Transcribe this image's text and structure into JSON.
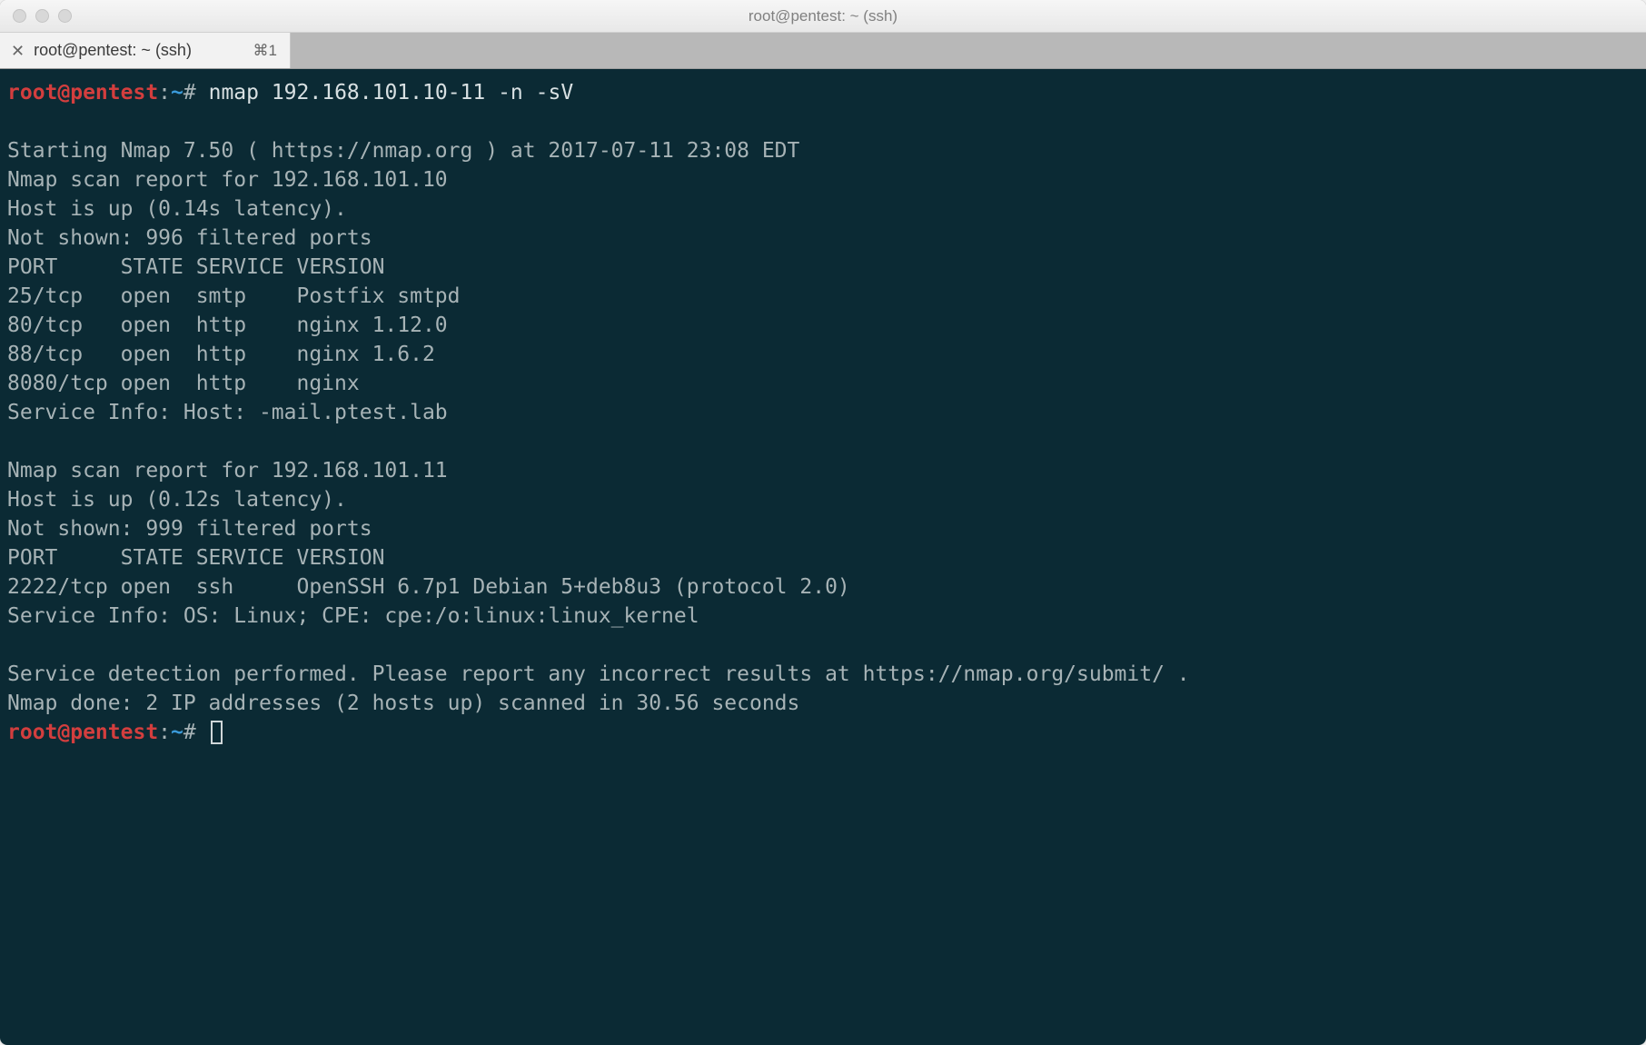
{
  "window": {
    "title": "root@pentest: ~ (ssh)"
  },
  "tab": {
    "label": "root@pentest: ~ (ssh)",
    "shortcut": "⌘1"
  },
  "prompt": {
    "user_host": "root@pentest",
    "colon": ":",
    "path": "~",
    "hash": "# "
  },
  "command": "nmap 192.168.101.10-11 -n -sV",
  "output": {
    "line1": "",
    "line2": "Starting Nmap 7.50 ( https://nmap.org ) at 2017-07-11 23:08 EDT",
    "line3": "Nmap scan report for 192.168.101.10",
    "line4": "Host is up (0.14s latency).",
    "line5": "Not shown: 996 filtered ports",
    "line6": "PORT     STATE SERVICE VERSION",
    "line7": "25/tcp   open  smtp    Postfix smtpd",
    "line8": "80/tcp   open  http    nginx 1.12.0",
    "line9": "88/tcp   open  http    nginx 1.6.2",
    "line10": "8080/tcp open  http    nginx",
    "line11": "Service Info: Host: -mail.ptest.lab",
    "line12": "",
    "line13": "Nmap scan report for 192.168.101.11",
    "line14": "Host is up (0.12s latency).",
    "line15": "Not shown: 999 filtered ports",
    "line16": "PORT     STATE SERVICE VERSION",
    "line17": "2222/tcp open  ssh     OpenSSH 6.7p1 Debian 5+deb8u3 (protocol 2.0)",
    "line18": "Service Info: OS: Linux; CPE: cpe:/o:linux:linux_kernel",
    "line19": "",
    "line20": "Service detection performed. Please report any incorrect results at https://nmap.org/submit/ .",
    "line21": "Nmap done: 2 IP addresses (2 hosts up) scanned in 30.56 seconds"
  }
}
